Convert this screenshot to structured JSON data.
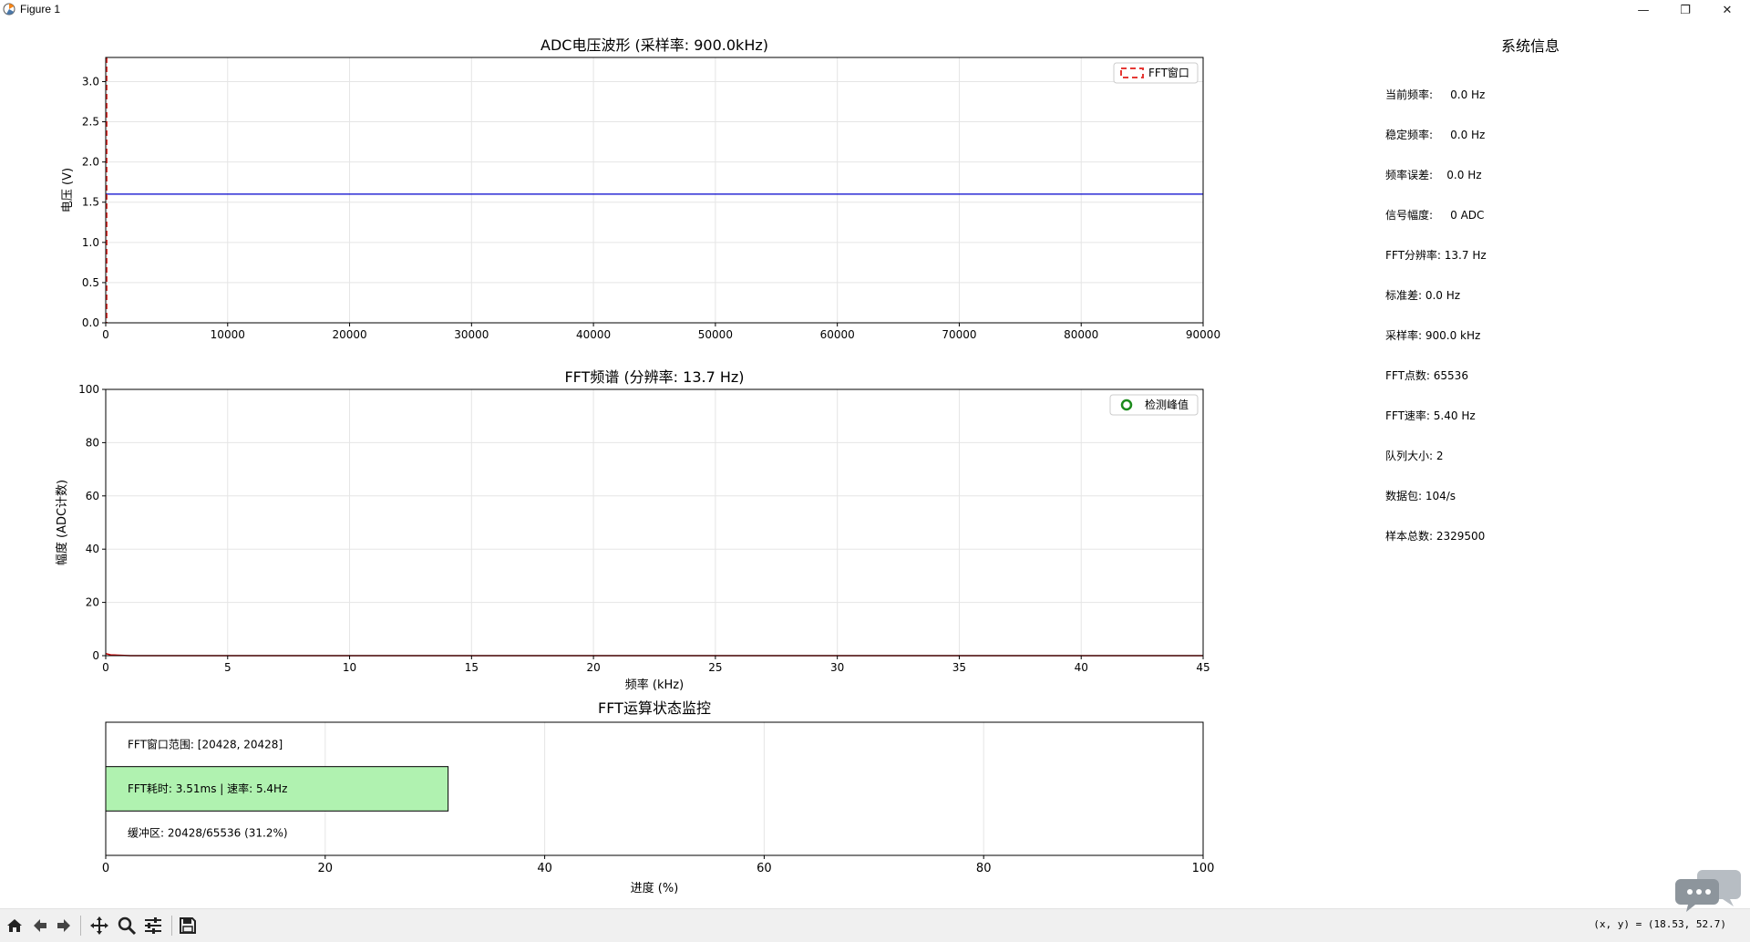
{
  "window": {
    "title": "Figure 1",
    "minimize_glyph": "—",
    "maximize_glyph": "❐",
    "close_glyph": "✕"
  },
  "colors": {
    "waveform_line": "#0000cc",
    "fft_window_marker": "#e53935",
    "spectrum_line": "#cc0000",
    "peak_marker": "#1b8a1b",
    "progress_fill": "#b0f2b0",
    "grid": "#e5e5e5"
  },
  "chart_data": [
    {
      "type": "line",
      "title": "ADC电压波形 (采样率: 900.0kHz)",
      "xlabel": "",
      "ylabel": "电压 (V)",
      "xlim": [
        0,
        90000
      ],
      "ylim": [
        0.0,
        3.3
      ],
      "x_ticks": [
        "0",
        "10000",
        "20000",
        "30000",
        "40000",
        "50000",
        "60000",
        "70000",
        "80000",
        "90000"
      ],
      "y_ticks": [
        "0.0",
        "0.5",
        "1.0",
        "1.5",
        "2.0",
        "2.5",
        "3.0"
      ],
      "grid": true,
      "legend": {
        "position": "top-right",
        "entries": [
          {
            "label": "FFT窗口",
            "style": "dashed"
          }
        ]
      },
      "series": [
        {
          "x": [
            0,
            10000,
            20000,
            30000,
            40000,
            50000,
            60000,
            70000,
            80000,
            90000
          ],
          "values": [
            1.6,
            1.6,
            1.6,
            1.6,
            1.6,
            1.6,
            1.6,
            1.6,
            1.6,
            1.6
          ]
        }
      ],
      "fft_window_x": 0
    },
    {
      "type": "line",
      "title": "FFT频谱 (分辨率: 13.7 Hz)",
      "xlabel": "频率 (kHz)",
      "ylabel": "幅度 (ADC计数)",
      "xlim": [
        0,
        45
      ],
      "ylim": [
        0,
        100
      ],
      "x_ticks": [
        "0",
        "5",
        "10",
        "15",
        "20",
        "25",
        "30",
        "35",
        "40",
        "45"
      ],
      "y_ticks": [
        "0",
        "20",
        "40",
        "60",
        "80",
        "100"
      ],
      "grid": true,
      "legend": {
        "position": "top-right",
        "entries": [
          {
            "label": "检测峰值",
            "style": "circle"
          }
        ]
      },
      "series": [
        {
          "x": [
            0,
            0.2,
            1,
            45
          ],
          "values": [
            0.8,
            0.3,
            0,
            0
          ]
        }
      ]
    },
    {
      "type": "bar",
      "orientation": "horizontal",
      "title": "FFT运算状态监控",
      "xlabel": "进度 (%)",
      "xlim": [
        0,
        100
      ],
      "x_ticks": [
        "0",
        "20",
        "40",
        "60",
        "80",
        "100"
      ],
      "grid": true,
      "categories": [
        "FFT窗口范围: [20428, 20428]",
        "FFT耗时: 3.51ms | 速率: 5.4Hz",
        "缓冲区: 20428/65536 (31.2%)"
      ],
      "values": [
        0,
        31.2,
        0
      ]
    }
  ],
  "info": {
    "title": "系统信息",
    "rows": [
      "当前频率:     0.0 Hz",
      "稳定频率:     0.0 Hz",
      "频率误差:    0.0 Hz",
      "信号幅度:     0 ADC",
      "FFT分辨率: 13.7 Hz",
      "标准差: 0.0 Hz",
      "采样率: 900.0 kHz",
      "FFT点数: 65536",
      "FFT速率: 5.40 Hz",
      "队列大小: 2",
      "数据包: 104/s",
      "样本总数: 2329500"
    ]
  },
  "toolbar": {
    "buttons": [
      "home-icon",
      "back-icon",
      "forward-icon",
      "pan-icon",
      "zoom-icon",
      "configure-subplots-icon",
      "save-icon"
    ],
    "coords": "(x, y) = (18.53, 52.7)"
  }
}
